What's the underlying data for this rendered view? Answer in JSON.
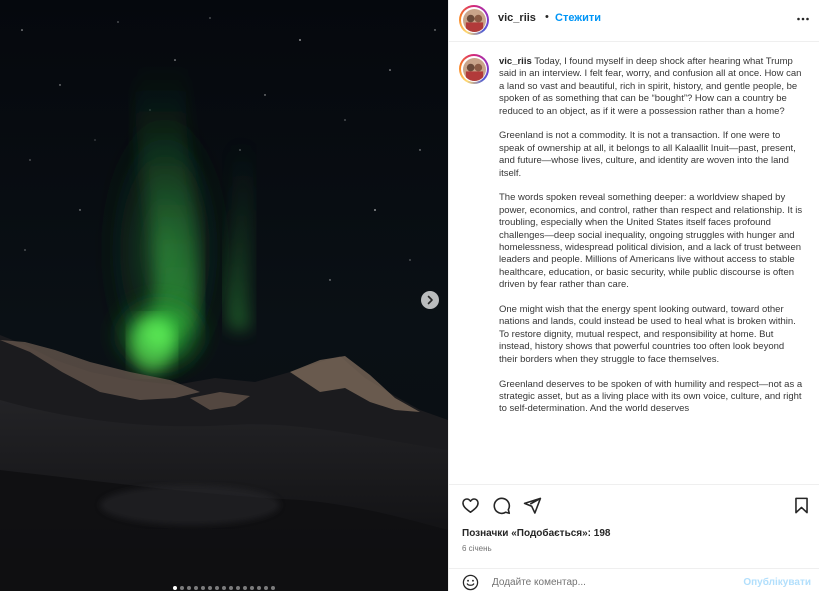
{
  "post": {
    "author": "vic_riis",
    "separator": "•",
    "follow_label": "Стежити",
    "more_icon": "more-horizontal-icon",
    "next_icon": "chevron-right-icon"
  },
  "carousel": {
    "count": 15,
    "active_index": 0
  },
  "caption": {
    "username": "vic_riis",
    "paragraphs": [
      "Today, I found myself in deep shock after hearing what Trump said in an interview. I felt fear, worry, and confusion all at once. How can a land so vast and beautiful, rich in spirit, history, and gentle people, be spoken of as something that can be “bought”? How can a country be reduced to an object, as if it were a possession rather than a home?",
      "Greenland is not a commodity. It is not a transaction. If one were to speak of ownership at all, it belongs to all Kalaallit Inuit—past, present, and future—whose lives, culture, and identity are woven into the land itself.",
      "The words spoken reveal something deeper: a worldview shaped by power, economics, and control, rather than respect and relationship. It is troubling, especially when the United States itself faces profound challenges—deep social inequality, ongoing struggles with hunger and homelessness, widespread political division, and a lack of trust between leaders and people. Millions of Americans live without access to stable healthcare, education, or basic security, while public discourse is often driven by fear rather than care.",
      "One might wish that the energy spent looking outward, toward other nations and lands, could instead be used to heal what is broken within. To restore dignity, mutual respect, and responsibility at home. But instead, history shows that powerful countries too often look beyond their borders when they struggle to face themselves.",
      "Greenland deserves to be spoken of with humility and respect—not as a strategic asset, but as a living place with its own voice, culture, and right to self-determination. And the world deserves"
    ]
  },
  "actions": {
    "icons": [
      "heart-icon",
      "comment-icon",
      "share-icon",
      "bookmark-icon"
    ],
    "likes_text": "Позначки «Подобається»: 198",
    "date_text": "6 січень"
  },
  "comment": {
    "emoji_icon": "emoji-icon",
    "placeholder": "Додайте коментар...",
    "value": "",
    "publish_label": "Опублікувати"
  },
  "colors": {
    "accent": "#0095f6",
    "publish_disabled": "#b2dffc",
    "text": "#262626",
    "muted": "#737373",
    "aurora": "#3fdc4a"
  }
}
